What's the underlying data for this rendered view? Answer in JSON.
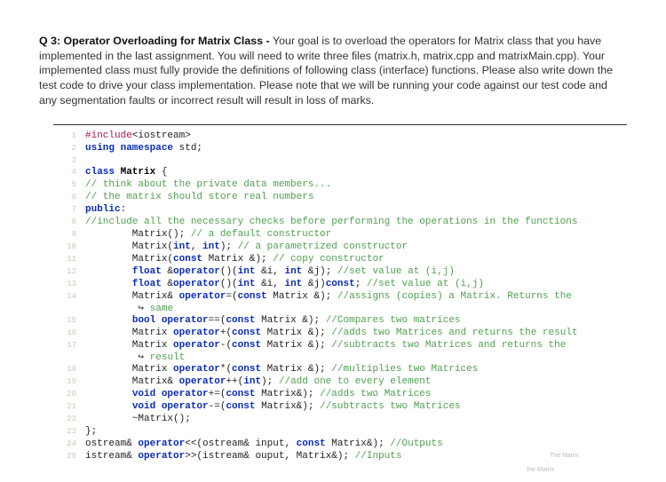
{
  "question": {
    "lead": "Q 3: Operator Overloading for Matrix Class - ",
    "body": "Your goal is to overload the operators for Matrix class that you have implemented in the last assignment. You will need to write three files (matrix.h, matrix.cpp and matrixMain.cpp). Your implemented class must fully provide the definitions of following class (interface) functions. Please also write down the test code to drive your class implementation. Please note that we will be running your code against our test code and any segmentation faults or incorrect result will result in loss of marks."
  },
  "code": {
    "lines": [
      {
        "n": 1,
        "segs": [
          {
            "cls": "kw-pp",
            "t": "#include"
          },
          {
            "cls": "",
            "t": "<iostream>"
          }
        ]
      },
      {
        "n": 2,
        "segs": [
          {
            "cls": "kw-blue",
            "t": "using namespace "
          },
          {
            "cls": "",
            "t": "std;"
          }
        ]
      },
      {
        "n": 3,
        "segs": [
          {
            "cls": "",
            "t": ""
          }
        ]
      },
      {
        "n": 4,
        "segs": [
          {
            "cls": "kw-blue",
            "t": "class "
          },
          {
            "cls": "cname",
            "t": "Matrix"
          },
          {
            "cls": "",
            "t": " {"
          }
        ]
      },
      {
        "n": 5,
        "segs": [
          {
            "cls": "cmt",
            "t": "// think about the private data members..."
          }
        ]
      },
      {
        "n": 6,
        "segs": [
          {
            "cls": "cmt",
            "t": "// the matrix should store real numbers"
          }
        ]
      },
      {
        "n": 7,
        "segs": [
          {
            "cls": "kw-blue",
            "t": "public"
          },
          {
            "cls": "",
            "t": ":"
          }
        ]
      },
      {
        "n": 8,
        "segs": [
          {
            "cls": "cmt",
            "t": "//include all the necessary checks before performing the operations in the functions"
          }
        ]
      },
      {
        "n": 9,
        "segs": [
          {
            "cls": "",
            "t": "        Matrix(); "
          },
          {
            "cls": "cmt",
            "t": "// a default constructor"
          }
        ]
      },
      {
        "n": 10,
        "segs": [
          {
            "cls": "",
            "t": "        Matrix("
          },
          {
            "cls": "kw-blue",
            "t": "int"
          },
          {
            "cls": "",
            "t": ", "
          },
          {
            "cls": "kw-blue",
            "t": "int"
          },
          {
            "cls": "",
            "t": "); "
          },
          {
            "cls": "cmt",
            "t": "// a parametrized constructor"
          }
        ]
      },
      {
        "n": 11,
        "segs": [
          {
            "cls": "",
            "t": "        Matrix("
          },
          {
            "cls": "kw-blue",
            "t": "const"
          },
          {
            "cls": "",
            "t": " Matrix &); "
          },
          {
            "cls": "cmt",
            "t": "// copy constructor"
          }
        ]
      },
      {
        "n": 12,
        "segs": [
          {
            "cls": "",
            "t": "        "
          },
          {
            "cls": "kw-blue",
            "t": "float"
          },
          {
            "cls": "",
            "t": " &"
          },
          {
            "cls": "kw-blue",
            "t": "operator"
          },
          {
            "cls": "",
            "t": "()("
          },
          {
            "cls": "kw-blue",
            "t": "int"
          },
          {
            "cls": "",
            "t": " &i, "
          },
          {
            "cls": "kw-blue",
            "t": "int"
          },
          {
            "cls": "",
            "t": " &j); "
          },
          {
            "cls": "cmt",
            "t": "//set value at (i,j)"
          }
        ]
      },
      {
        "n": 13,
        "segs": [
          {
            "cls": "",
            "t": "        "
          },
          {
            "cls": "kw-blue",
            "t": "float"
          },
          {
            "cls": "",
            "t": " &"
          },
          {
            "cls": "kw-blue",
            "t": "operator"
          },
          {
            "cls": "",
            "t": "()("
          },
          {
            "cls": "kw-blue",
            "t": "int"
          },
          {
            "cls": "",
            "t": " &i, "
          },
          {
            "cls": "kw-blue",
            "t": "int"
          },
          {
            "cls": "",
            "t": " &j)"
          },
          {
            "cls": "kw-blue",
            "t": "const"
          },
          {
            "cls": "",
            "t": "; "
          },
          {
            "cls": "cmt",
            "t": "//set value at (i,j)"
          }
        ]
      },
      {
        "n": 14,
        "segs": [
          {
            "cls": "",
            "t": "        Matrix& "
          },
          {
            "cls": "kw-blue",
            "t": "operator"
          },
          {
            "cls": "",
            "t": "=("
          },
          {
            "cls": "kw-blue",
            "t": "const"
          },
          {
            "cls": "",
            "t": " Matrix &); "
          },
          {
            "cls": "cmt",
            "t": "//assigns (copies) a Matrix. Returns the"
          }
        ]
      },
      {
        "n": "",
        "segs": [
          {
            "cls": "",
            "t": "         ↪ "
          },
          {
            "cls": "cmt",
            "t": "same"
          }
        ]
      },
      {
        "n": 15,
        "segs": [
          {
            "cls": "",
            "t": "        "
          },
          {
            "cls": "kw-blue",
            "t": "bool operator"
          },
          {
            "cls": "",
            "t": "==("
          },
          {
            "cls": "kw-blue",
            "t": "const"
          },
          {
            "cls": "",
            "t": " Matrix &); "
          },
          {
            "cls": "cmt",
            "t": "//Compares two matrices"
          }
        ]
      },
      {
        "n": 16,
        "segs": [
          {
            "cls": "",
            "t": "        Matrix "
          },
          {
            "cls": "kw-blue",
            "t": "operator"
          },
          {
            "cls": "",
            "t": "+("
          },
          {
            "cls": "kw-blue",
            "t": "const"
          },
          {
            "cls": "",
            "t": " Matrix &); "
          },
          {
            "cls": "cmt",
            "t": "//adds two Matrices and returns the result"
          }
        ]
      },
      {
        "n": 17,
        "segs": [
          {
            "cls": "",
            "t": "        Matrix "
          },
          {
            "cls": "kw-blue",
            "t": "operator"
          },
          {
            "cls": "",
            "t": "-("
          },
          {
            "cls": "kw-blue",
            "t": "const"
          },
          {
            "cls": "",
            "t": " Matrix &); "
          },
          {
            "cls": "cmt",
            "t": "//subtracts two Matrices and returns the"
          }
        ]
      },
      {
        "n": "",
        "segs": [
          {
            "cls": "",
            "t": "         ↪ "
          },
          {
            "cls": "cmt",
            "t": "result"
          }
        ]
      },
      {
        "n": 18,
        "segs": [
          {
            "cls": "",
            "t": "        Matrix "
          },
          {
            "cls": "kw-blue",
            "t": "operator"
          },
          {
            "cls": "",
            "t": "*("
          },
          {
            "cls": "kw-blue",
            "t": "const"
          },
          {
            "cls": "",
            "t": " Matrix &); "
          },
          {
            "cls": "cmt",
            "t": "//multiplies two Matrices"
          }
        ]
      },
      {
        "n": 19,
        "segs": [
          {
            "cls": "",
            "t": "        Matrix& "
          },
          {
            "cls": "kw-blue",
            "t": "operator"
          },
          {
            "cls": "",
            "t": "++("
          },
          {
            "cls": "kw-blue",
            "t": "int"
          },
          {
            "cls": "",
            "t": "); "
          },
          {
            "cls": "cmt",
            "t": "//add one to every element"
          }
        ]
      },
      {
        "n": 20,
        "segs": [
          {
            "cls": "",
            "t": "        "
          },
          {
            "cls": "kw-blue",
            "t": "void operator"
          },
          {
            "cls": "",
            "t": "+=("
          },
          {
            "cls": "kw-blue",
            "t": "const"
          },
          {
            "cls": "",
            "t": " Matrix&); "
          },
          {
            "cls": "cmt",
            "t": "//adds two Matrices"
          }
        ]
      },
      {
        "n": 21,
        "segs": [
          {
            "cls": "",
            "t": "        "
          },
          {
            "cls": "kw-blue",
            "t": "void operator"
          },
          {
            "cls": "",
            "t": "-=("
          },
          {
            "cls": "kw-blue",
            "t": "const"
          },
          {
            "cls": "",
            "t": " Matrix&); "
          },
          {
            "cls": "cmt",
            "t": "//subtracts two Matrices"
          }
        ]
      },
      {
        "n": 22,
        "segs": [
          {
            "cls": "",
            "t": "        ~Matrix();"
          }
        ]
      },
      {
        "n": 23,
        "segs": [
          {
            "cls": "",
            "t": "};"
          }
        ]
      },
      {
        "n": 24,
        "segs": [
          {
            "cls": "",
            "t": "ostream& "
          },
          {
            "cls": "kw-blue",
            "t": "operator"
          },
          {
            "cls": "",
            "t": "<<(ostream& input, "
          },
          {
            "cls": "kw-blue",
            "t": "const"
          },
          {
            "cls": "",
            "t": " Matrix&); "
          },
          {
            "cls": "cmt",
            "t": "//Outputs"
          }
        ]
      },
      {
        "n": 25,
        "segs": [
          {
            "cls": "",
            "t": "istream& "
          },
          {
            "cls": "kw-blue",
            "t": "operator"
          },
          {
            "cls": "",
            "t": ">>(istream& ouput, Matrix&); "
          },
          {
            "cls": "cmt",
            "t": "//Inputs"
          }
        ]
      }
    ]
  },
  "watermarks": {
    "wm1": "The Matrix",
    "wm2": "the Matrix"
  }
}
